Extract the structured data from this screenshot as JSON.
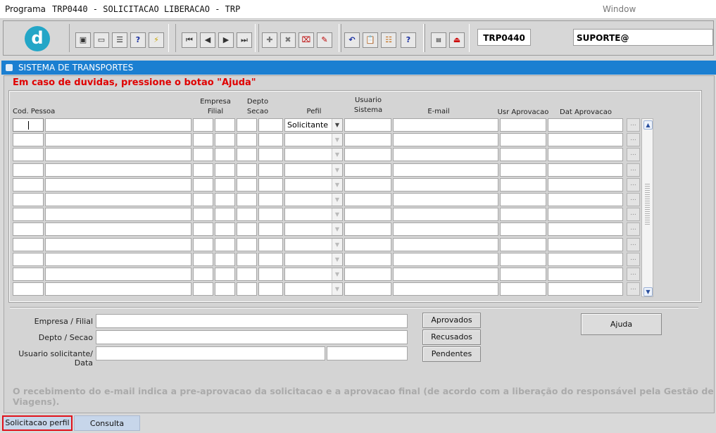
{
  "menubar": {
    "programa": "Programa",
    "title": "TRP0440 - SOLICITACAO LIBERACAO - TRP",
    "window": "Window"
  },
  "toolbar": {
    "logo_letter": "d",
    "program_code": "TRP0440",
    "user": "SUPORTE@",
    "icons": [
      "save-icon",
      "print-preview-icon",
      "print-icon",
      "query-help-icon",
      "execute-query-icon",
      "first-record-icon",
      "previous-record-icon",
      "next-record-icon",
      "last-record-icon",
      "insert-record-icon",
      "delete-record-icon",
      "clear-record-icon",
      "edit-record-icon",
      "undo-icon",
      "clipboard-icon",
      "list-values-icon",
      "help-icon",
      "menu-icon",
      "exit-icon"
    ]
  },
  "window": {
    "title": "SISTEMA DE TRANSPORTES"
  },
  "help_message": "Em caso de duvidas, pressione o botao \"Ajuda\"",
  "grid": {
    "headers": {
      "cod_pessoa": "Cod. Pessoa",
      "empresa": "Empresa",
      "filial": "Filial",
      "depto": "Depto",
      "secao": "Secao",
      "pefil": "Pefil",
      "usuario": "Usuario",
      "sistema": "Sistema",
      "email": "E-mail",
      "usr_aprovacao": "Usr Aprovacao",
      "dat_aprovacao": "Dat Aprovacao"
    },
    "first_row_perfil": "Solicitante",
    "row_count": 12,
    "lov_button": "..."
  },
  "filters": {
    "empresa_filial_label": "Empresa / Filial",
    "depto_secao_label": "Depto / Secao",
    "usuario_label": "Usuario solicitante/ Data"
  },
  "buttons": {
    "aprovados": "Aprovados",
    "recusados": "Recusados",
    "pendentes": "Pendentes",
    "ajuda": "Ajuda"
  },
  "footnote": "O recebimento do e-mail indica a pre-aprovacao da solicitacao e a aprovacao final (de acordo com a liberação do responsável pela Gestão de Viagens).",
  "tabs": {
    "active": "Solicitacao perfil",
    "other": "Consulta"
  }
}
